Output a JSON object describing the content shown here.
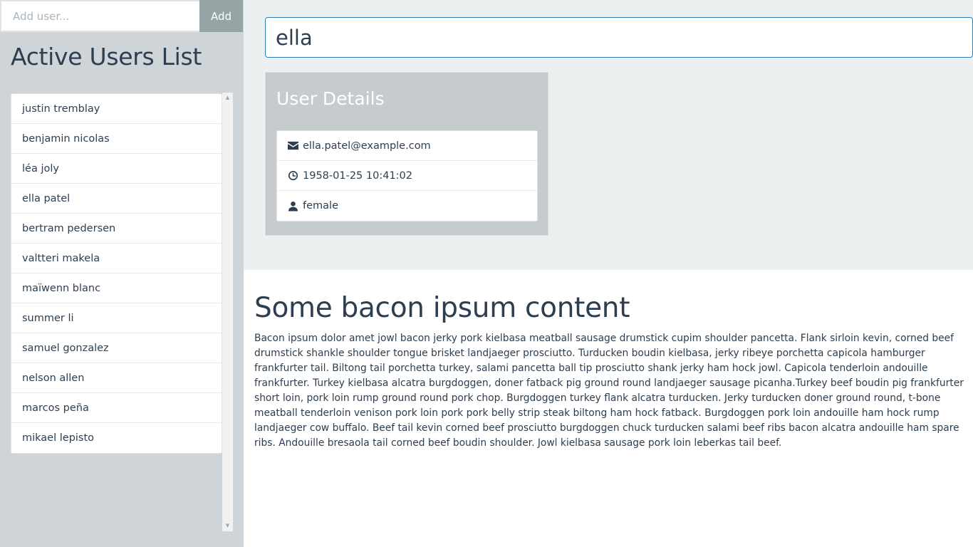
{
  "sidebar": {
    "add_placeholder": "Add user...",
    "add_label": "Add",
    "title": "Active Users List",
    "users": [
      "justin tremblay",
      "benjamin nicolas",
      "léa joly",
      "ella patel",
      "bertram pedersen",
      "valtteri makela",
      "maïwenn blanc",
      "summer li",
      "samuel gonzalez",
      "nelson allen",
      "marcos peña",
      "mikael lepisto"
    ]
  },
  "search": {
    "value": "ella"
  },
  "details": {
    "title": "User Details",
    "email": "ella.patel@example.com",
    "dob": "1958-01-25 10:41:02",
    "gender": "female"
  },
  "content": {
    "title": "Some bacon ipsum content",
    "body": "Bacon ipsum dolor amet jowl bacon jerky pork kielbasa meatball sausage drumstick cupim shoulder pancetta. Flank sirloin kevin, corned beef drumstick shankle shoulder tongue brisket landjaeger prosciutto. Turducken boudin kielbasa, jerky ribeye porchetta capicola hamburger frankfurter tail. Biltong tail porchetta turkey, salami pancetta ball tip prosciutto shank jerky ham hock jowl. Capicola tenderloin andouille frankfurter. Turkey kielbasa alcatra burgdoggen, doner fatback pig ground round landjaeger sausage picanha.Turkey beef boudin pig frankfurter short loin, pork loin rump ground round pork chop. Burgdoggen turkey flank alcatra turducken. Jerky turducken doner ground round, t-bone meatball tenderloin venison pork loin pork pork belly strip steak biltong ham hock fatback. Burgdoggen pork loin andouille ham hock rump landjaeger cow buffalo. Beef tail kevin corned beef prosciutto burgdoggen chuck turducken salami beef ribs bacon alcatra andouille ham spare ribs. Andouille bresaola tail corned beef boudin shoulder. Jowl kielbasa sausage pork loin leberkas tail beef."
  },
  "icons": {
    "email": "envelope-icon",
    "dob": "clock-icon",
    "gender": "user-icon",
    "scroll_up": "caret-up-icon",
    "scroll_down": "caret-down-icon"
  }
}
